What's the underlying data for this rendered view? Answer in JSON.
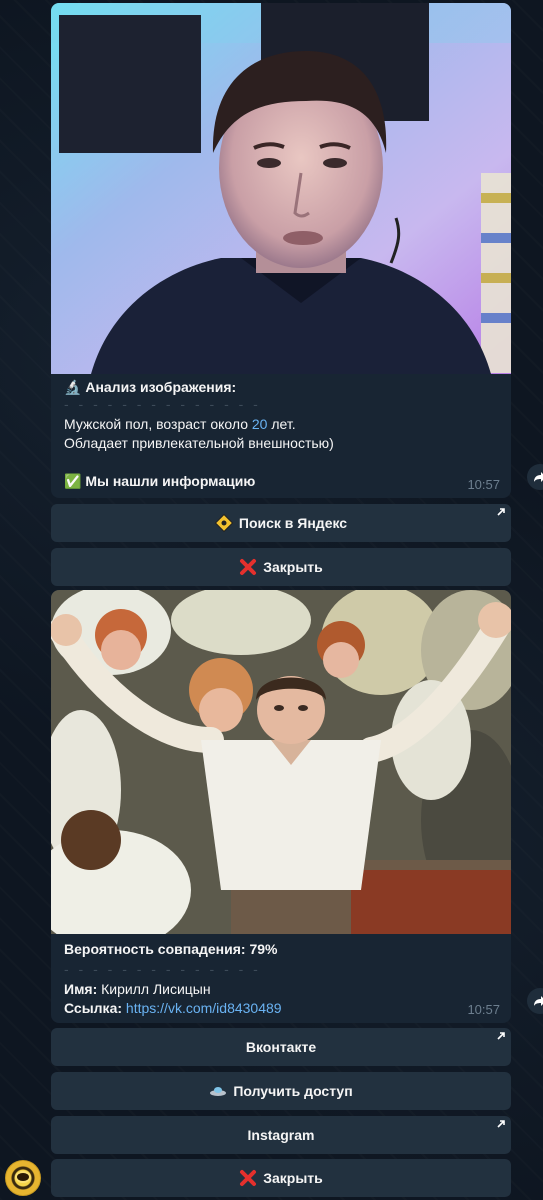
{
  "message1": {
    "caption_title": "Анализ изображения:",
    "divider": "- - - - - - - - - - - - - -",
    "line1_prefix": "Мужской пол, возраст около ",
    "line1_age": "20",
    "line1_suffix": " лет.",
    "line2": "Обладает привлекательной внешностью)",
    "found_text": "Мы нашли информацию",
    "time": "10:57"
  },
  "buttons1": {
    "yandex": "Поиск в Яндекс",
    "close": "Закрыть"
  },
  "message2": {
    "match_label": "Вероятность совпадения: 79%",
    "divider": "- - - - - - - - - - - - - -",
    "name_label": "Имя:",
    "name_value": "Кирилл Лисицын",
    "link_label": "Ссылка:",
    "link_value": "https://vk.com/id8430489",
    "time": "10:57"
  },
  "buttons2": {
    "vk": "Вконтакте",
    "access": "Получить доступ",
    "instagram": "Instagram",
    "close": "Закрыть"
  },
  "colors": {
    "background": "#0e1621",
    "bubble": "#182533",
    "button": "#22313f",
    "link": "#6ab3f3",
    "time": "#6d7f8f"
  }
}
